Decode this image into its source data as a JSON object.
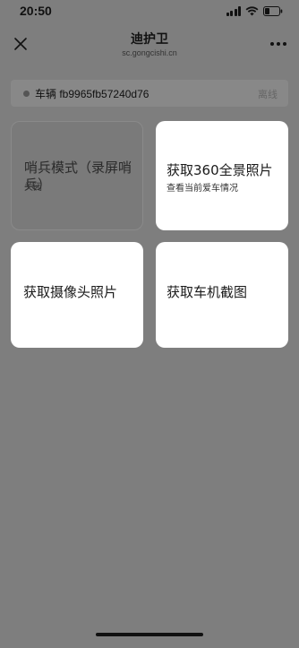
{
  "status_bar": {
    "time": "20:50"
  },
  "header": {
    "title": "迪护卫",
    "subtitle": "sc.gongcishi.cn"
  },
  "vehicle": {
    "label": "车辆 fb9965fb57240d76",
    "status": "离线"
  },
  "cards": {
    "sentry": {
      "title": "哨兵模式（录屏哨兵）",
      "subtitle": "关闭"
    },
    "panorama": {
      "title": "获取360全景照片",
      "subtitle": "查看当前爱车情况"
    },
    "camera": {
      "title": "获取摄像头照片"
    },
    "screenshot": {
      "title": "获取车机截图"
    }
  },
  "colors": {
    "overlay": "#7e7e7e",
    "card": "#ffffff"
  }
}
